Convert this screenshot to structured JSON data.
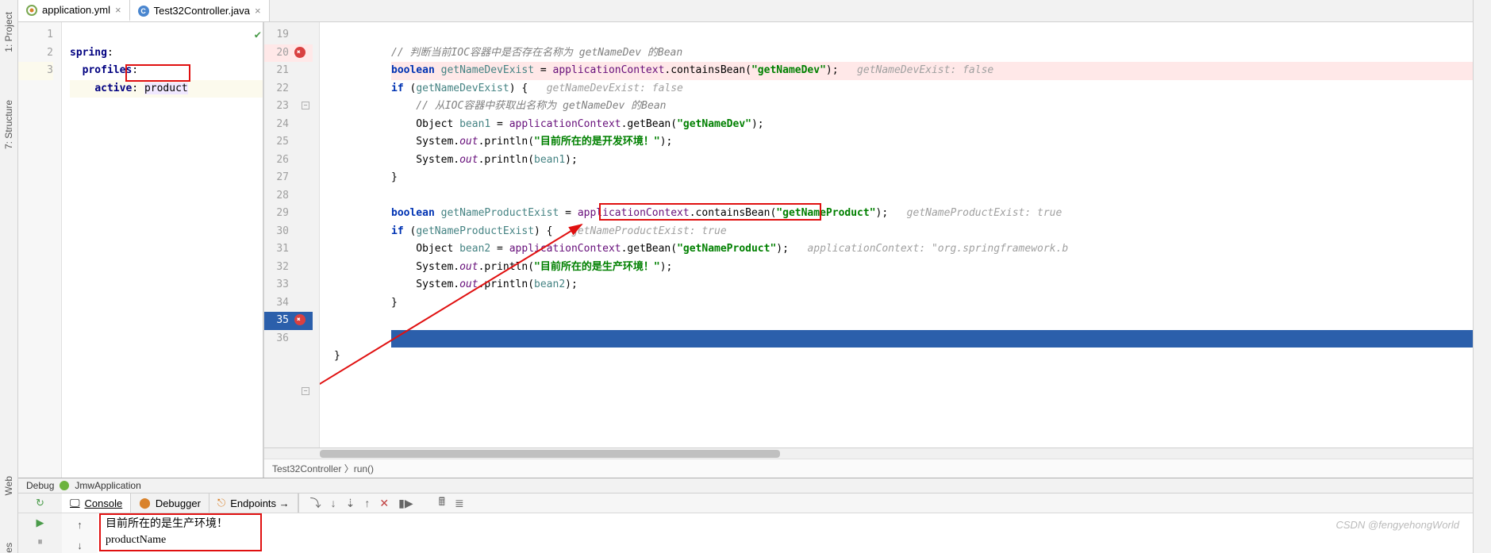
{
  "sidetools": [
    "1: Project",
    "7: Structure",
    "Web",
    "es"
  ],
  "tabs": [
    {
      "label": "application.yml",
      "icon": "yml"
    },
    {
      "label": "Test32Controller.java",
      "icon": "java"
    }
  ],
  "yml_editor": {
    "lines": [
      "1",
      "2",
      "3"
    ],
    "l1_key": "spring",
    "l1_colon": ":",
    "l2_key": "profiles",
    "l2_colon": ":",
    "l3_key": "active",
    "l3_colon": ": ",
    "l3_val": "product"
  },
  "java_editor": {
    "lines": [
      "19",
      "20",
      "21",
      "22",
      "23",
      "24",
      "25",
      "26",
      "27",
      "28",
      "29",
      "30",
      "31",
      "32",
      "33",
      "34",
      "35",
      "36"
    ],
    "l19": "// 判断当前IOC容器中是否存在名称为 getNameDev 的Bean",
    "l20_kw": "boolean ",
    "l20_var": "getNameDevExist",
    "l20_eq": " = ",
    "l20_ctx": "applicationContext",
    "l20_dot": ".containsBean(",
    "l20_str": "\"getNameDev\"",
    "l20_end": ");   ",
    "l20_hint": "getNameDevExist: false",
    "l21_kw": "if ",
    "l21_p": "(",
    "l21_var": "getNameDevExist",
    "l21_pe": ") {   ",
    "l21_hint": "getNameDevExist: false",
    "l22": "    // 从IOC容器中获取出名称为 getNameDev 的Bean",
    "l23_pre": "    Object ",
    "l23_var": "bean1",
    "l23_eq": " = ",
    "l23_ctx": "applicationContext",
    "l23_m": ".getBean(",
    "l23_str": "\"getNameDev\"",
    "l23_end": ");",
    "l24_pre": "    System.",
    "l24_out": "out",
    "l24_m": ".println(",
    "l24_str": "\"目前所在的是开发环境！\"",
    "l24_end": ");",
    "l25_pre": "    System.",
    "l25_out": "out",
    "l25_m": ".println(",
    "l25_var": "bean1",
    "l25_end": ");",
    "l26": "}",
    "l28_kw": "boolean ",
    "l28_var": "getNameProductExist",
    "l28_eq": " = ",
    "l28_ctx": "applicationContext",
    "l28_m": ".containsBean(",
    "l28_str": "\"getNameProduct\"",
    "l28_end": ");   ",
    "l28_hint": "getNameProductExist: true",
    "l29_kw": "if ",
    "l29_p": "(",
    "l29_var": "getNameProductExist",
    "l29_pe": ") {   ",
    "l29_hint": "getNameProductExist: true",
    "l30_pre": "    Object ",
    "l30_var": "bean2",
    "l30_eq": " = ",
    "l30_ctx": "applicationContext",
    "l30_m": ".getBean(",
    "l30_str": "\"getNameProduct\"",
    "l30_end": ");   ",
    "l30_hint": "applicationContext: \"org.springframework.b",
    "l31_pre": "    System.",
    "l31_out": "out",
    "l31_m": ".println(",
    "l31_str": "\"目前所在的是生产环境！\"",
    "l31_end": ");",
    "l32_pre": "    System.",
    "l32_out": "out",
    "l32_m": ".println(",
    "l32_var": "bean2",
    "l32_end": ");",
    "l33": "}",
    "l36": "}"
  },
  "breadcrumb": "Test32Controller 〉run()",
  "debug_title_prefix": "Debug ",
  "debug_title": "JmwApplication",
  "dbg_tabs": [
    "Console",
    "Debugger",
    "Endpoints →"
  ],
  "console": {
    "line1": "目前所在的是生产环境！",
    "line2": "productName"
  },
  "watermark": "CSDN @fengyehongWorld"
}
